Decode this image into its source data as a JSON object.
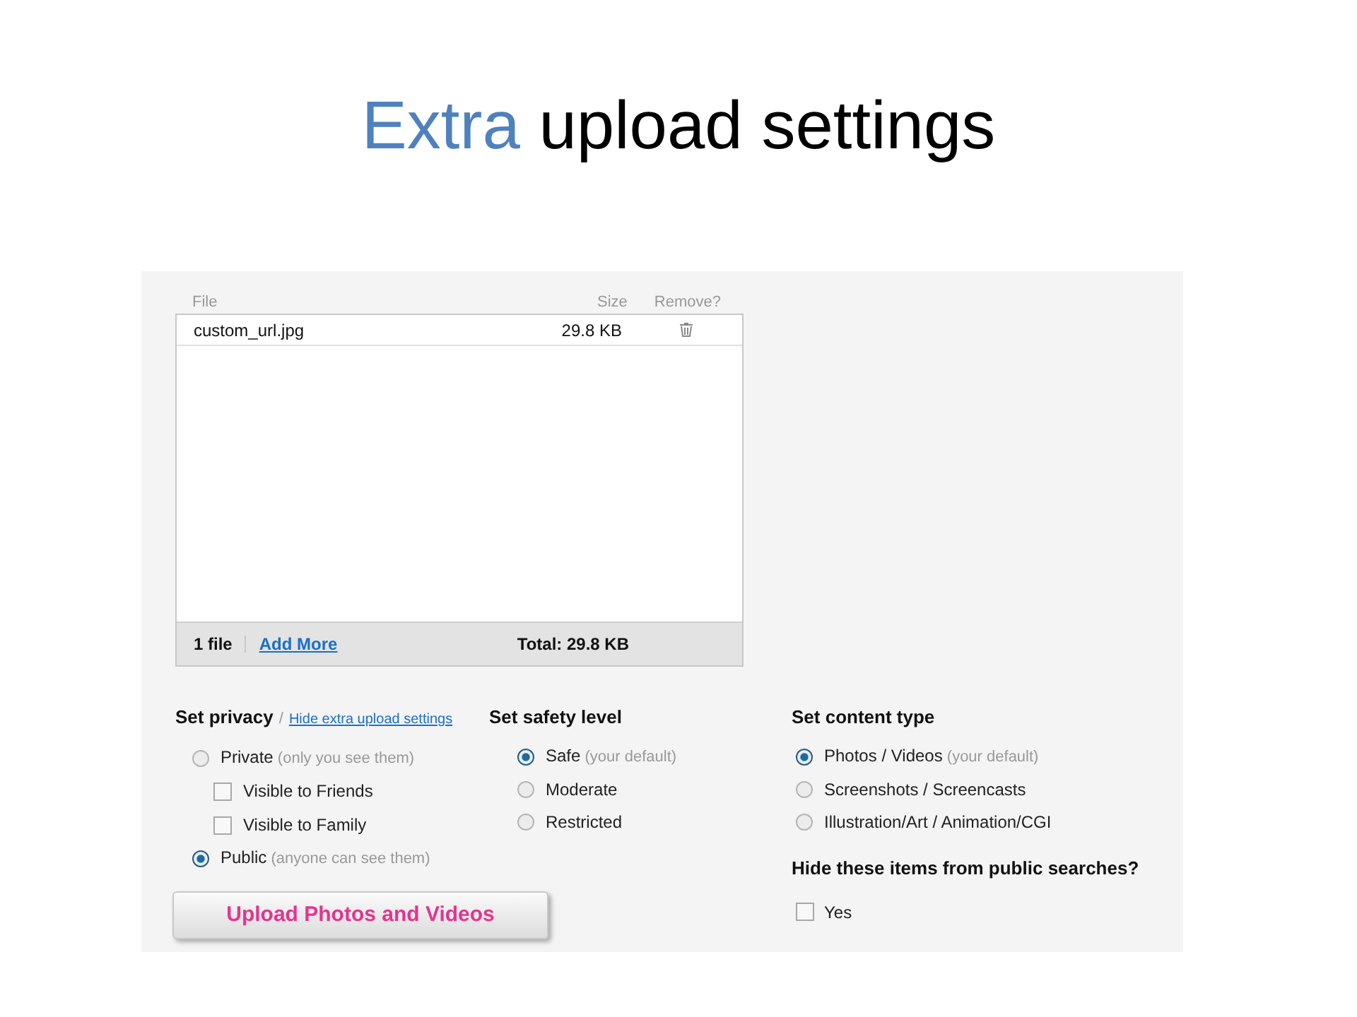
{
  "slide_title": {
    "highlight": "Extra",
    "rest": "upload settings"
  },
  "file_table": {
    "columns": [
      "File",
      "Size",
      "Remove?"
    ],
    "rows": [
      {
        "file": "custom_url.jpg",
        "size": "29.8 KB"
      }
    ],
    "footer": {
      "count": "1 file",
      "add_more": "Add More",
      "total": "Total: 29.8 KB"
    }
  },
  "privacy": {
    "title": "Set privacy",
    "separator": "/",
    "link": "Hide extra upload settings",
    "options": [
      {
        "label": "Private",
        "note": "(only you see them)",
        "selected": false,
        "children": [
          {
            "label": "Visible to Friends",
            "checked": false
          },
          {
            "label": "Visible to Family",
            "checked": false
          }
        ]
      },
      {
        "label": "Public",
        "note": "(anyone can see them)",
        "selected": true
      }
    ]
  },
  "safety": {
    "title": "Set safety level",
    "options": [
      {
        "label": "Safe",
        "note": "(your default)",
        "selected": true
      },
      {
        "label": "Moderate",
        "selected": false
      },
      {
        "label": "Restricted",
        "selected": false
      }
    ]
  },
  "content_type": {
    "title": "Set content type",
    "options": [
      {
        "label": "Photos / Videos",
        "note": "(your default)",
        "selected": true
      },
      {
        "label": "Screenshots / Screencasts",
        "selected": false
      },
      {
        "label": "Illustration/Art / Animation/CGI",
        "selected": false
      }
    ]
  },
  "hide_search": {
    "title": "Hide these items from public searches?",
    "label": "Yes",
    "checked": false
  },
  "upload_button": "Upload Photos and Videos"
}
